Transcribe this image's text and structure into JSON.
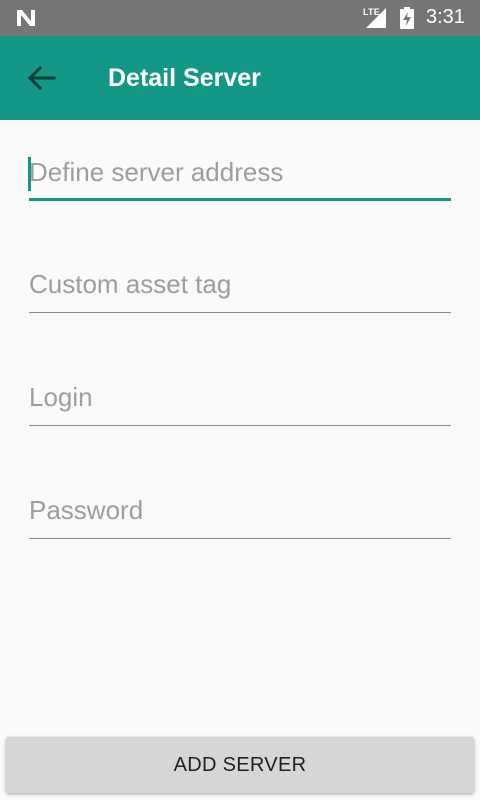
{
  "status_bar": {
    "network_type": "LTE",
    "time": "3:31",
    "icons": [
      "n-logo-icon",
      "signal-icon",
      "battery-charging-icon"
    ]
  },
  "app_bar": {
    "title": "Detail Server",
    "back_icon": "arrow-back-icon",
    "color": "#139786"
  },
  "form": {
    "fields": [
      {
        "placeholder": "Define server address",
        "value": "",
        "focused": true
      },
      {
        "placeholder": "Custom asset tag",
        "value": ""
      },
      {
        "placeholder": "Login",
        "value": ""
      },
      {
        "placeholder": "Password",
        "value": ""
      }
    ]
  },
  "add_button": {
    "label": "ADD SERVER"
  }
}
